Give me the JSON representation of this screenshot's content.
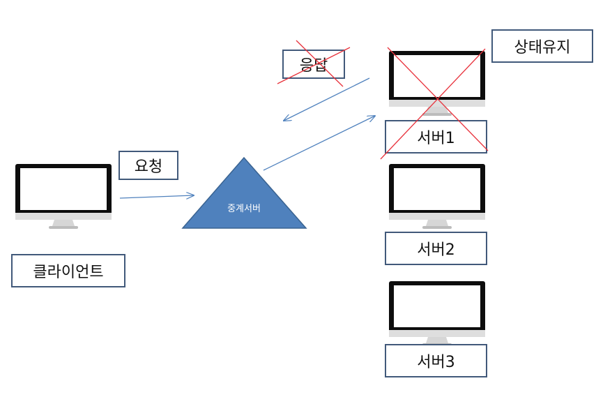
{
  "client": {
    "label": "클라이언트",
    "icon": "monitor-icon"
  },
  "request": {
    "label": "요청"
  },
  "response": {
    "label": "응답",
    "struck_out": true
  },
  "relay": {
    "label": "중계서버",
    "color": "#4f81bd"
  },
  "session_note": {
    "label": "상태유지"
  },
  "servers": [
    {
      "label": "서버1",
      "icon": "monitor-icon",
      "struck_out": true
    },
    {
      "label": "서버2",
      "icon": "monitor-icon",
      "struck_out": false
    },
    {
      "label": "서버3",
      "icon": "monitor-icon",
      "struck_out": false
    }
  ],
  "colors": {
    "arrow": "#4f81bd",
    "box_border": "#41597a",
    "cross": "#e8323c"
  }
}
